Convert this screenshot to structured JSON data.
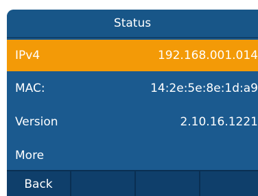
{
  "screen": {
    "title": "Status",
    "rows": [
      {
        "label": "IPv4",
        "value": "192.168.001.014",
        "selected": true
      },
      {
        "label": "MAC:",
        "value": "14:2e:5e:8e:1d:a9",
        "selected": false
      },
      {
        "label": "Version",
        "value": "2.10.16.1221",
        "selected": false
      },
      {
        "label": "More",
        "value": "",
        "selected": false
      }
    ],
    "softkeys": [
      "Back",
      "",
      "",
      ""
    ]
  },
  "colors": {
    "background": "#1b5a8f",
    "selected_row": "#f39a07",
    "softkey_bar": "#0f3f6b",
    "text": "#ffffff"
  }
}
